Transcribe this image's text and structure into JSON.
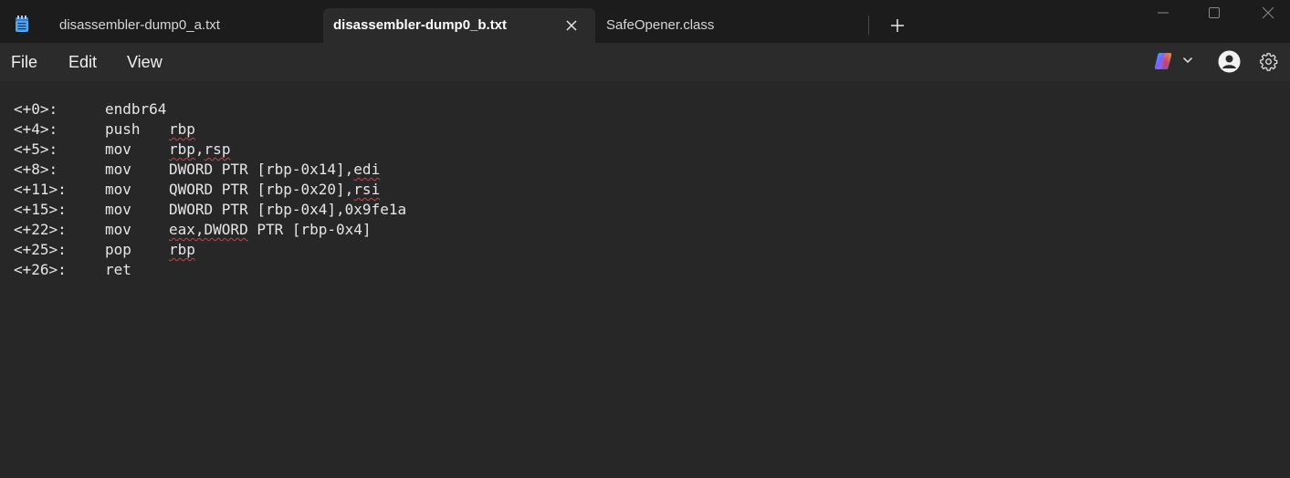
{
  "tabs": [
    {
      "label": "disassembler-dump0_a.txt",
      "active": false
    },
    {
      "label": "disassembler-dump0_b.txt",
      "active": true
    },
    {
      "label": "SafeOpener.class",
      "active": false
    }
  ],
  "menu": {
    "file": "File",
    "edit": "Edit",
    "view": "View"
  },
  "editor": {
    "lines": [
      {
        "offset": "<+0>:",
        "op": "endbr64",
        "args": []
      },
      {
        "offset": "<+4>:",
        "op": "push",
        "args": [
          {
            "t": "rbp",
            "sq": true
          }
        ]
      },
      {
        "offset": "<+5>:",
        "op": "mov",
        "args": [
          {
            "t": "rbp",
            "sq": true
          },
          {
            "t": ",",
            "sq": false
          },
          {
            "t": "rsp",
            "sq": true
          }
        ]
      },
      {
        "offset": "<+8>:",
        "op": "mov",
        "args": [
          {
            "t": "DWORD PTR [rbp-0x14],",
            "sq": false
          },
          {
            "t": "edi",
            "sq": true
          }
        ]
      },
      {
        "offset": "<+11>:",
        "op": "mov",
        "args": [
          {
            "t": "QWORD PTR [rbp-0x20],",
            "sq": false
          },
          {
            "t": "rsi",
            "sq": true
          }
        ]
      },
      {
        "offset": "<+15>:",
        "op": "mov",
        "args": [
          {
            "t": "DWORD PTR [rbp-0x4],0x9fe1a",
            "sq": false
          }
        ]
      },
      {
        "offset": "<+22>:",
        "op": "mov",
        "args": [
          {
            "t": "eax,DWORD",
            "sq": true
          },
          {
            "t": " PTR [rbp-0x4]",
            "sq": false
          }
        ]
      },
      {
        "offset": "<+25>:",
        "op": "pop",
        "args": [
          {
            "t": "rbp",
            "sq": true
          }
        ]
      },
      {
        "offset": "<+26>:",
        "op": "ret",
        "args": []
      }
    ]
  },
  "icons": {
    "app": "notepad-icon",
    "close_tab": "close-icon",
    "new_tab": "plus-icon",
    "minimize": "minimize-icon",
    "maximize": "maximize-icon",
    "close_window": "close-window-icon",
    "copilot": "copilot-icon",
    "dropdown": "chevron-down-icon",
    "account": "avatar-icon",
    "settings": "gear-icon"
  },
  "colors": {
    "background": "#272727",
    "titlebar": "#1c1c1c",
    "spell_squiggle": "#e0393e"
  }
}
